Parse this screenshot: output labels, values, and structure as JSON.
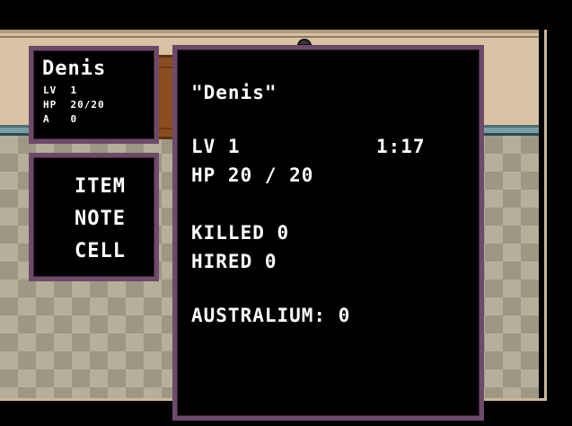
{
  "player": {
    "name": "Denis",
    "name_quoted": "\"Denis\""
  },
  "mini_stats": {
    "lv": "LV  1",
    "hp": "HP  20/20",
    "a": "A   0"
  },
  "menu": {
    "items": [
      "ITEM",
      "NOTE",
      "CELL"
    ]
  },
  "panel": {
    "lv": "LV 1",
    "time": "1:17",
    "hp": "HP 20 / 20",
    "killed": "KILLED 0",
    "hired": "HIRED 0",
    "australium": "AUSTRALIUM: 0"
  },
  "colors": {
    "box_border": "#6e4a6a",
    "text": "#ffffff",
    "background": "#000000"
  }
}
